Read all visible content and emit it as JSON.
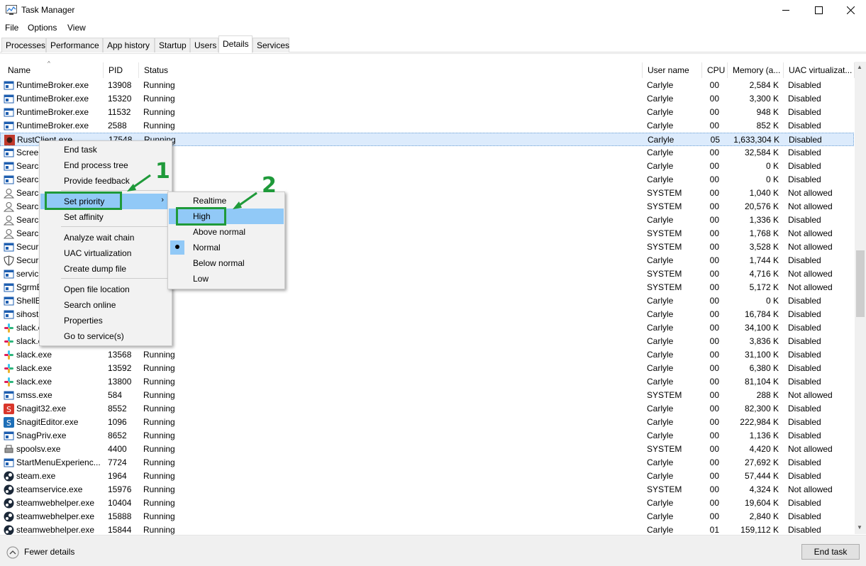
{
  "window": {
    "title": "Task Manager",
    "minimize_icon": "minimize-icon",
    "maximize_icon": "maximize-icon",
    "close_icon": "close-icon"
  },
  "menubar": {
    "file": "File",
    "options": "Options",
    "view": "View"
  },
  "tabs": [
    "Processes",
    "Performance",
    "App history",
    "Startup",
    "Users",
    "Details",
    "Services"
  ],
  "active_tab": "Details",
  "columns": {
    "name": "Name",
    "pid": "PID",
    "status": "Status",
    "user": "User name",
    "cpu": "CPU",
    "memory": "Memory (a...",
    "uac": "UAC virtualizat..."
  },
  "rows": [
    {
      "name": "RuntimeBroker.exe",
      "pid": "13908",
      "status": "Running",
      "user": "Carlyle",
      "cpu": "00",
      "mem": "2,584 K",
      "uac": "Disabled",
      "icon": "app-window-icon"
    },
    {
      "name": "RuntimeBroker.exe",
      "pid": "15320",
      "status": "Running",
      "user": "Carlyle",
      "cpu": "00",
      "mem": "3,300 K",
      "uac": "Disabled",
      "icon": "app-window-icon"
    },
    {
      "name": "RuntimeBroker.exe",
      "pid": "11532",
      "status": "Running",
      "user": "Carlyle",
      "cpu": "00",
      "mem": "948 K",
      "uac": "Disabled",
      "icon": "app-window-icon"
    },
    {
      "name": "RuntimeBroker.exe",
      "pid": "2588",
      "status": "Running",
      "user": "Carlyle",
      "cpu": "00",
      "mem": "852 K",
      "uac": "Disabled",
      "icon": "app-window-icon"
    },
    {
      "name": "RustClient.exe",
      "pid": "17548",
      "status": "Running",
      "user": "Carlyle",
      "cpu": "05",
      "mem": "1,633,304 K",
      "uac": "Disabled",
      "icon": "rust-icon"
    },
    {
      "name": "Screen",
      "pid": "",
      "status": "",
      "user": "Carlyle",
      "cpu": "00",
      "mem": "32,584 K",
      "uac": "Disabled",
      "icon": "app-window-icon"
    },
    {
      "name": "Search",
      "pid": "",
      "status": "ded",
      "user": "Carlyle",
      "cpu": "00",
      "mem": "0 K",
      "uac": "Disabled",
      "icon": "app-window-icon"
    },
    {
      "name": "Search",
      "pid": "",
      "status": "ded",
      "user": "Carlyle",
      "cpu": "00",
      "mem": "0 K",
      "uac": "Disabled",
      "icon": "app-window-icon"
    },
    {
      "name": "Search",
      "pid": "",
      "status": "",
      "user": "SYSTEM",
      "cpu": "00",
      "mem": "1,040 K",
      "uac": "Not allowed",
      "icon": "user-service-icon"
    },
    {
      "name": "Search",
      "pid": "",
      "status": "",
      "user": "SYSTEM",
      "cpu": "00",
      "mem": "20,576 K",
      "uac": "Not allowed",
      "icon": "user-service-icon"
    },
    {
      "name": "Search",
      "pid": "",
      "status": "",
      "user": "Carlyle",
      "cpu": "00",
      "mem": "1,336 K",
      "uac": "Disabled",
      "icon": "user-service-icon"
    },
    {
      "name": "Search",
      "pid": "",
      "status": "",
      "user": "SYSTEM",
      "cpu": "00",
      "mem": "1,768 K",
      "uac": "Not allowed",
      "icon": "user-service-icon"
    },
    {
      "name": "Securi",
      "pid": "",
      "status": "",
      "user": "SYSTEM",
      "cpu": "00",
      "mem": "3,528 K",
      "uac": "Not allowed",
      "icon": "app-window-icon"
    },
    {
      "name": "Securi",
      "pid": "",
      "status": "",
      "user": "Carlyle",
      "cpu": "00",
      "mem": "1,744 K",
      "uac": "Disabled",
      "icon": "shield-icon"
    },
    {
      "name": "servic",
      "pid": "",
      "status": "",
      "user": "SYSTEM",
      "cpu": "00",
      "mem": "4,716 K",
      "uac": "Not allowed",
      "icon": "app-window-icon"
    },
    {
      "name": "SgrmE",
      "pid": "",
      "status": "",
      "user": "SYSTEM",
      "cpu": "00",
      "mem": "5,172 K",
      "uac": "Not allowed",
      "icon": "app-window-icon"
    },
    {
      "name": "ShellE",
      "pid": "",
      "status": "ded",
      "user": "Carlyle",
      "cpu": "00",
      "mem": "0 K",
      "uac": "Disabled",
      "icon": "app-window-icon"
    },
    {
      "name": "sihost",
      "pid": "",
      "status": "",
      "user": "Carlyle",
      "cpu": "00",
      "mem": "16,784 K",
      "uac": "Disabled",
      "icon": "app-window-icon"
    },
    {
      "name": "slack.e",
      "pid": "",
      "status": "",
      "user": "Carlyle",
      "cpu": "00",
      "mem": "34,100 K",
      "uac": "Disabled",
      "icon": "slack-icon"
    },
    {
      "name": "slack.e",
      "pid": "",
      "status": "",
      "user": "Carlyle",
      "cpu": "00",
      "mem": "3,836 K",
      "uac": "Disabled",
      "icon": "slack-icon"
    },
    {
      "name": "slack.exe",
      "pid": "13568",
      "status": "Running",
      "user": "Carlyle",
      "cpu": "00",
      "mem": "31,100 K",
      "uac": "Disabled",
      "icon": "slack-icon"
    },
    {
      "name": "slack.exe",
      "pid": "13592",
      "status": "Running",
      "user": "Carlyle",
      "cpu": "00",
      "mem": "6,380 K",
      "uac": "Disabled",
      "icon": "slack-icon"
    },
    {
      "name": "slack.exe",
      "pid": "13800",
      "status": "Running",
      "user": "Carlyle",
      "cpu": "00",
      "mem": "81,104 K",
      "uac": "Disabled",
      "icon": "slack-icon"
    },
    {
      "name": "smss.exe",
      "pid": "584",
      "status": "Running",
      "user": "SYSTEM",
      "cpu": "00",
      "mem": "288 K",
      "uac": "Not allowed",
      "icon": "app-window-icon"
    },
    {
      "name": "Snagit32.exe",
      "pid": "8552",
      "status": "Running",
      "user": "Carlyle",
      "cpu": "00",
      "mem": "82,300 K",
      "uac": "Disabled",
      "icon": "snagit-icon"
    },
    {
      "name": "SnagitEditor.exe",
      "pid": "1096",
      "status": "Running",
      "user": "Carlyle",
      "cpu": "00",
      "mem": "222,984 K",
      "uac": "Disabled",
      "icon": "snagit-editor-icon"
    },
    {
      "name": "SnagPriv.exe",
      "pid": "8652",
      "status": "Running",
      "user": "Carlyle",
      "cpu": "00",
      "mem": "1,136 K",
      "uac": "Disabled",
      "icon": "app-window-icon"
    },
    {
      "name": "spoolsv.exe",
      "pid": "4400",
      "status": "Running",
      "user": "SYSTEM",
      "cpu": "00",
      "mem": "4,420 K",
      "uac": "Not allowed",
      "icon": "printer-icon"
    },
    {
      "name": "StartMenuExperienc...",
      "pid": "7724",
      "status": "Running",
      "user": "Carlyle",
      "cpu": "00",
      "mem": "27,692 K",
      "uac": "Disabled",
      "icon": "app-window-icon"
    },
    {
      "name": "steam.exe",
      "pid": "1964",
      "status": "Running",
      "user": "Carlyle",
      "cpu": "00",
      "mem": "57,444 K",
      "uac": "Disabled",
      "icon": "steam-icon"
    },
    {
      "name": "steamservice.exe",
      "pid": "15976",
      "status": "Running",
      "user": "SYSTEM",
      "cpu": "00",
      "mem": "4,324 K",
      "uac": "Not allowed",
      "icon": "steam-icon"
    },
    {
      "name": "steamwebhelper.exe",
      "pid": "10404",
      "status": "Running",
      "user": "Carlyle",
      "cpu": "00",
      "mem": "19,604 K",
      "uac": "Disabled",
      "icon": "steam-icon"
    },
    {
      "name": "steamwebhelper.exe",
      "pid": "15888",
      "status": "Running",
      "user": "Carlyle",
      "cpu": "00",
      "mem": "2,840 K",
      "uac": "Disabled",
      "icon": "steam-icon"
    },
    {
      "name": "steamwebhelper.exe",
      "pid": "15844",
      "status": "Running",
      "user": "Carlyle",
      "cpu": "01",
      "mem": "159,112 K",
      "uac": "Disabled",
      "icon": "steam-icon"
    }
  ],
  "selected_row": "RustClient.exe",
  "context_menu": {
    "end_task": "End task",
    "end_process_tree": "End process tree",
    "provide_feedback": "Provide feedback",
    "set_priority": "Set priority",
    "set_affinity": "Set affinity",
    "analyze_wait_chain": "Analyze wait chain",
    "uac_virtualization": "UAC virtualization",
    "create_dump_file": "Create dump file",
    "open_file_location": "Open file location",
    "search_online": "Search online",
    "properties": "Properties",
    "go_to_services": "Go to service(s)"
  },
  "priority_submenu": {
    "realtime": "Realtime",
    "high": "High",
    "above_normal": "Above normal",
    "normal": "Normal",
    "below_normal": "Below normal",
    "low": "Low",
    "current": "Normal"
  },
  "annotations": {
    "step1": "1",
    "step2": "2",
    "color": "#1f9a3a"
  },
  "footer": {
    "fewer_details": "Fewer details",
    "end_task": "End task"
  }
}
